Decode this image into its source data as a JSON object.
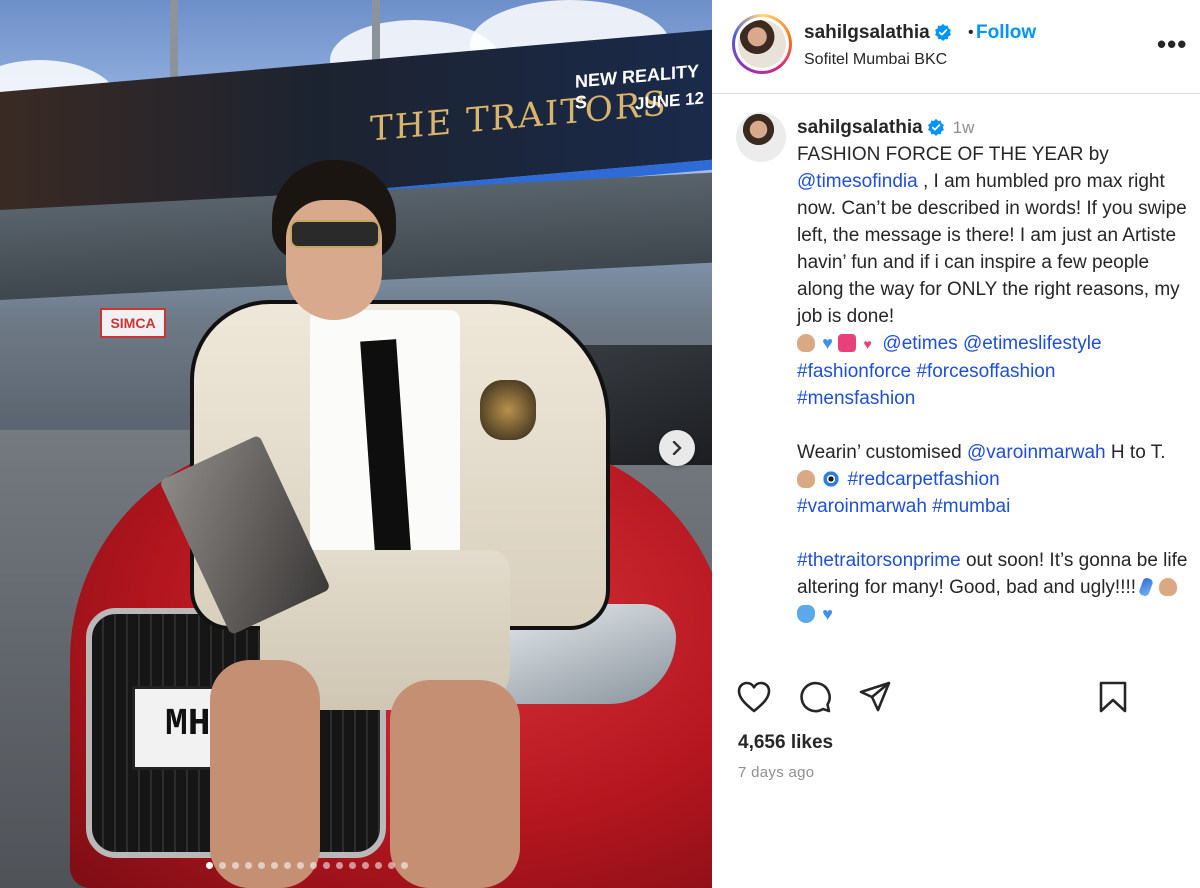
{
  "media": {
    "billboard_title": "THE TRAITORS",
    "billboard_tagline": "NEW REALITY S",
    "billboard_date": "JUNE 12",
    "store_sign": "SIMCA",
    "plate_text": "MH0",
    "carousel_dot_count": 16,
    "carousel_active_index": 0
  },
  "header": {
    "username": "sahilgsalathia",
    "separator": "•",
    "follow_label": "Follow",
    "location": "Sofitel Mumbai BKC",
    "more_label": "•••"
  },
  "caption": {
    "username": "sahilgsalathia",
    "time_ago": "1w",
    "line1": "FASHION FORCE OF THE YEAR by",
    "mention_toi": "@timesofindia",
    "body1": " , I am humbled pro max right now. Can’t be described in words! If you swipe left, the message is there! I am just an Artiste havin’ fun and if i can inspire a few people along the way for ONLY the right reasons, my job is done!",
    "mention_etimes": "@etimes",
    "mention_etimeslifestyle": "@etimeslifestyle",
    "tag_fashionforce": "#fashionforce",
    "tag_forcesoffashion": "#forcesoffashion",
    "tag_mensfashion": "#mensfashion",
    "body2_prefix": "Wearin’ customised ",
    "mention_varoin": "@varoinmarwah",
    "body2_suffix": " H to T. ",
    "tag_redcarpet": "#redcarpetfashion",
    "tag_varoinmarwah": "#varoinmarwah",
    "tag_mumbai": "#mumbai",
    "tag_traitors": "#thetraitorsonprime",
    "body3": " out soon! It’s gonna be life altering for many! Good, bad and ugly!!!! "
  },
  "actions": {
    "likes": "4,656 likes",
    "posted": "7 days ago"
  },
  "colors": {
    "link": "#1f4fd6",
    "follow": "#0095f6",
    "muted": "#8e8e8e"
  },
  "icons": [
    "heart-icon",
    "comment-icon",
    "share-icon",
    "bookmark-icon",
    "verified-icon",
    "more-icon",
    "chevron-right-icon"
  ]
}
